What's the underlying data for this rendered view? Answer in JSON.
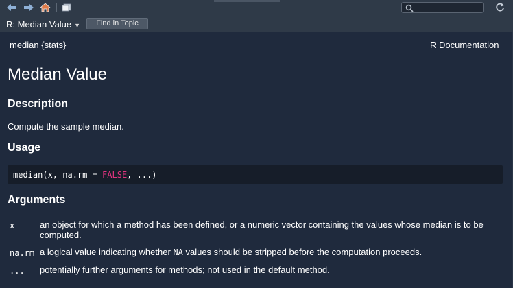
{
  "toolbar": {
    "back_icon": "arrow-left-icon",
    "forward_icon": "arrow-right-icon",
    "home_icon": "home-icon",
    "popout_icon": "popout-icon",
    "search_placeholder": "",
    "search_icon": "search-icon",
    "refresh_icon": "refresh-icon"
  },
  "topic": {
    "title": "R: Median Value",
    "find_label": "Find in Topic"
  },
  "doc": {
    "package": "median {stats}",
    "doc_type": "R Documentation",
    "title": "Median Value",
    "description_heading": "Description",
    "description": "Compute the sample median.",
    "usage_heading": "Usage",
    "usage": {
      "pre": "median(x, na.rm = ",
      "keyword": "FALSE",
      "post": ", ...)"
    },
    "arguments_heading": "Arguments",
    "arguments": [
      {
        "name": "x",
        "line1": "an object for which a method has been defined, or a numeric vector containing the values whose median is to be",
        "line2": "computed."
      },
      {
        "name": "na.rm",
        "pre": "a logical value indicating whether ",
        "code": "NA",
        "post": " values should be stripped before the computation proceeds."
      },
      {
        "name": "...",
        "text": "potentially further arguments for methods; not used in the default method."
      }
    ]
  },
  "colors": {
    "background": "#1f2a3d",
    "toolbar": "#2f3a48",
    "code_bg": "#161d29",
    "keyword": "#e0337e",
    "home_icon": "#e07c4a"
  }
}
